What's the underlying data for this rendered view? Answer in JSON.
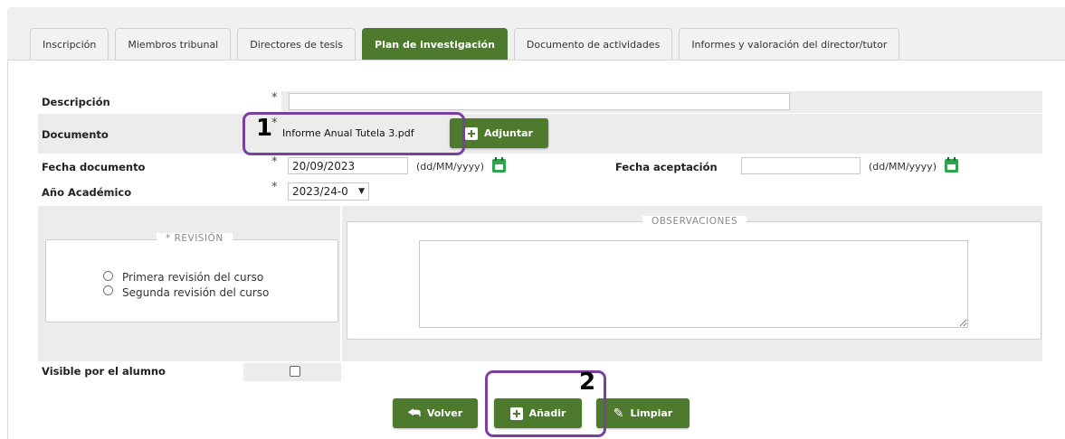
{
  "tabs": [
    {
      "label": "Inscripción"
    },
    {
      "label": "Miembros tribunal"
    },
    {
      "label": "Directores de tesis"
    },
    {
      "label": "Plan de investigación"
    },
    {
      "label": "Documento de actividades"
    },
    {
      "label": "Informes y valoración del director/tutor"
    }
  ],
  "form": {
    "descripcion_label": "Descripción",
    "descripcion_value": "",
    "required_mark": "*",
    "documento_label": "Documento",
    "documento_file": "Informe Anual Tutela 3.pdf",
    "adjuntar_label": "Adjuntar",
    "fecha_documento_label": "Fecha documento",
    "fecha_documento_value": "20/09/2023",
    "date_format": "(dd/MM/yyyy)",
    "fecha_aceptacion_label": "Fecha aceptación",
    "fecha_aceptacion_value": "",
    "anio_label": "Año Académico",
    "anio_value": "2023/24-0",
    "revision_legend": "* REVISIÓN",
    "revision_options": [
      "Primera revisión del curso",
      "Segunda revisión del curso"
    ],
    "observaciones_legend": "OBSERVACIONES",
    "observaciones_value": "",
    "visible_label": "Visible por el alumno"
  },
  "buttons": {
    "volver": "Volver",
    "anadir": "Añadir",
    "limpiar": "Limpiar"
  },
  "annotations": {
    "one": "1",
    "two": "2"
  },
  "colors": {
    "accent_green": "#4e7a2e",
    "annotation_purple": "#7b3fa0",
    "calendar_green": "#2ea44f"
  }
}
